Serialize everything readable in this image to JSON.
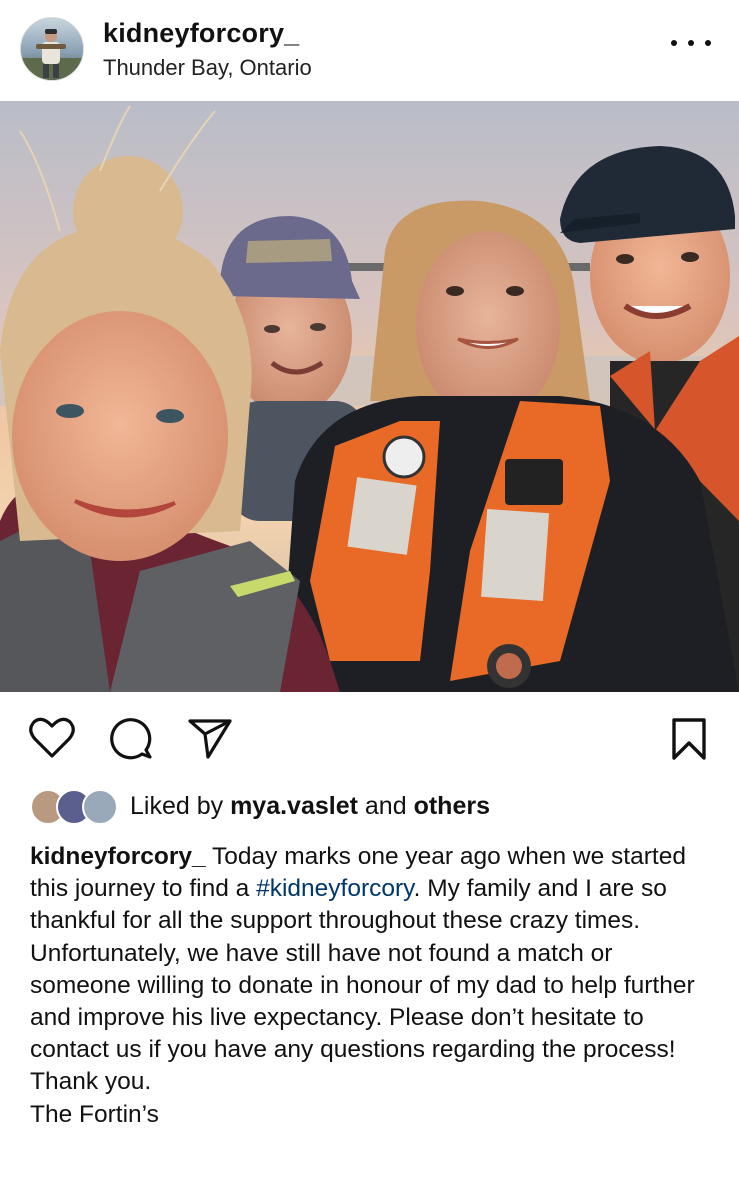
{
  "header": {
    "username": "kidneyforcory_",
    "location": "Thunder Bay, Ontario"
  },
  "post": {
    "image": "four people smiling wearing life vests on a boat at sunset"
  },
  "likes": {
    "prefix": "Liked by",
    "first_liker": "mya.vaslet",
    "joiner": "and",
    "others": "others"
  },
  "caption": {
    "username": "kidneyforcory_",
    "text_part1": "Today marks one year ago when we started  this journey to find a",
    "hashtag": "#kidneyforcory",
    "text_part2": ". My family and I are so thankful for all the support throughout these crazy times. Unfortunately, we have still have not found a match or someone willing to donate in honour of my dad to help further and improve his live expectancy. Please don’t hesitate to contact us if you have any questions regarding the process!",
    "line2": "Thank you.",
    "line3": "The Fortin’s"
  },
  "icons": {
    "more": "more-options-icon",
    "like": "heart-icon",
    "comment": "comment-icon",
    "share": "send-icon",
    "save": "bookmark-icon"
  },
  "colors": {
    "hashtag": "#00376b",
    "text": "#111111",
    "background": "#ffffff"
  }
}
